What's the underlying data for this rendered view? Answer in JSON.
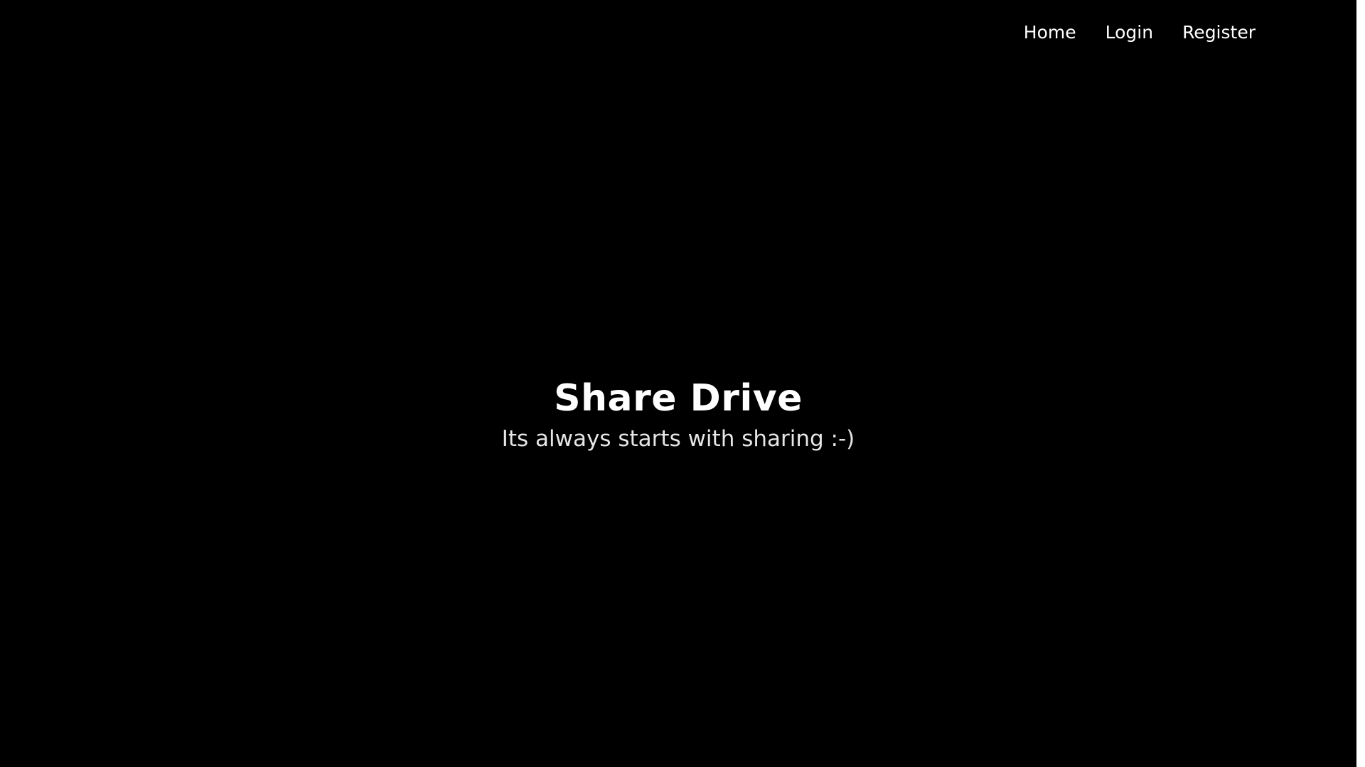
{
  "nav": {
    "items": [
      {
        "label": "Home"
      },
      {
        "label": "Login"
      },
      {
        "label": "Register"
      }
    ]
  },
  "hero": {
    "title": "Share Drive",
    "subtitle": "Its always starts with sharing :-)"
  },
  "colors": {
    "background": "#000000",
    "text": "#ffffff",
    "subtitle": "#e6e6e6",
    "scrollbar": "#ffffff"
  }
}
